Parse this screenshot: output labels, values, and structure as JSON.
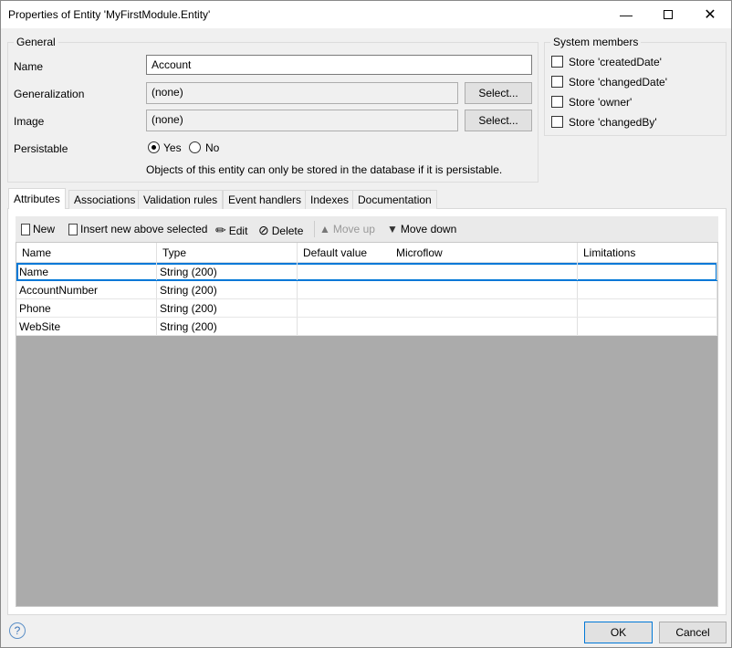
{
  "window": {
    "title": "Properties of Entity 'MyFirstModule.Entity'"
  },
  "general": {
    "legend": "General",
    "name_label": "Name",
    "name_value": "Account",
    "generalization_label": "Generalization",
    "generalization_value": "(none)",
    "image_label": "Image",
    "image_value": "(none)",
    "select_label": "Select...",
    "persistable_label": "Persistable",
    "yes_label": "Yes",
    "no_label": "No",
    "persistable_selected": "Yes",
    "note": "Objects of this entity can only be stored in the database if it is persistable."
  },
  "system": {
    "legend": "System members",
    "items": [
      {
        "label": "Store 'createdDate'",
        "checked": false
      },
      {
        "label": "Store 'changedDate'",
        "checked": false
      },
      {
        "label": "Store 'owner'",
        "checked": false
      },
      {
        "label": "Store 'changedBy'",
        "checked": false
      }
    ]
  },
  "tabs": [
    "Attributes",
    "Associations",
    "Validation rules",
    "Event handlers",
    "Indexes",
    "Documentation"
  ],
  "toolbar": {
    "new": "New",
    "insert": "Insert new above selected",
    "edit": "Edit",
    "delete": "Delete",
    "move_up": "Move up",
    "move_down": "Move down"
  },
  "grid": {
    "columns": [
      "Name",
      "Type",
      "Default value",
      "Microflow",
      "Limitations"
    ],
    "rows": [
      [
        "Name",
        "String (200)",
        "",
        "",
        ""
      ],
      [
        "AccountNumber",
        "String (200)",
        "",
        "",
        ""
      ],
      [
        "Phone",
        "String (200)",
        "",
        "",
        ""
      ],
      [
        "WebSite",
        "String (200)",
        "",
        "",
        ""
      ]
    ]
  },
  "footer": {
    "ok": "OK",
    "cancel": "Cancel"
  }
}
